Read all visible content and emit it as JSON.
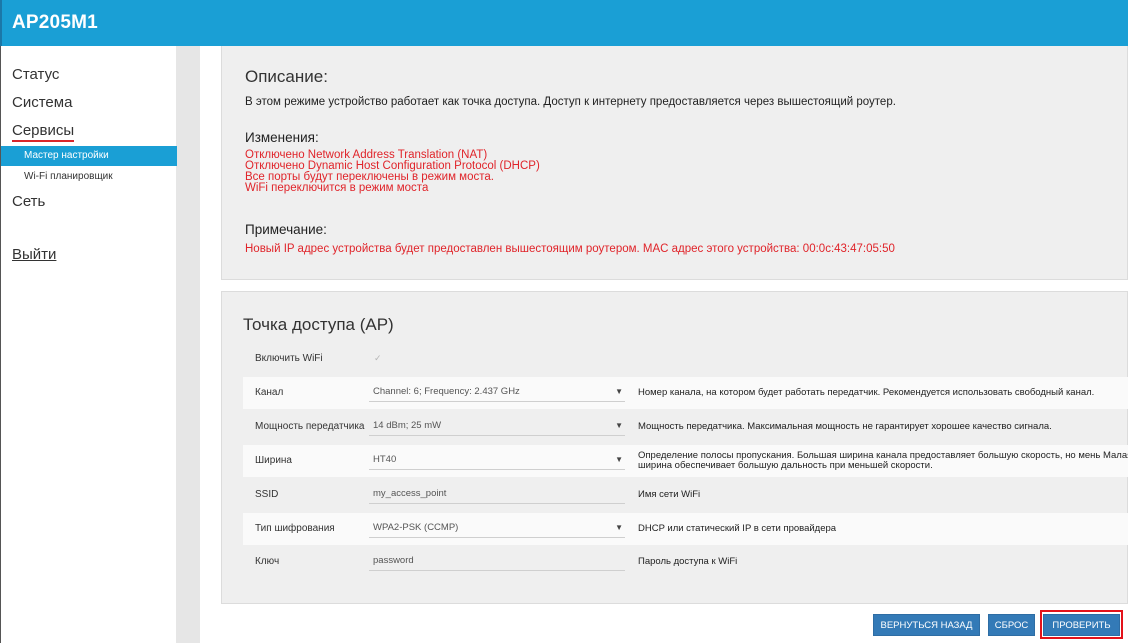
{
  "header": {
    "title": "AP205M1"
  },
  "sidebar": {
    "items": [
      {
        "label": "Статус"
      },
      {
        "label": "Система"
      },
      {
        "label": "Сервисы"
      },
      {
        "label": "Сеть"
      }
    ],
    "subitems": [
      {
        "label": "Мастер настройки",
        "active": true
      },
      {
        "label": "Wi-Fi планировщик",
        "active": false
      }
    ],
    "logout": "Выйти"
  },
  "description": {
    "heading": "Описание:",
    "text": "В этом режиме устройство работает как точка доступа. Доступ к интернету предоставляется через вышестоящий роутер."
  },
  "changes": {
    "heading": "Изменения:",
    "items": [
      "Отключено Network Address Translation (NAT)",
      "Отключено Dynamic Host Configuration Protocol (DHCP)",
      "Все порты будут переключены в режим моста.",
      "WiFi переключится в режим моста"
    ]
  },
  "note": {
    "heading": "Примечание:",
    "text": "Новый IP адрес устройства будет предоставлен вышестоящим роутером. MAC адрес этого устройства: 00:0c:43:47:05:50"
  },
  "ap_form": {
    "title": "Точка доступа (AP)",
    "enable_wifi": {
      "label": "Включить WiFi",
      "checked": true,
      "mark": "✓"
    },
    "channel": {
      "label": "Канал",
      "value": "Channel: 6; Frequency: 2.437 GHz",
      "help": "Номер канала, на котором будет работать передатчик. Рекомендуется использовать свободный канал."
    },
    "power": {
      "label": "Мощность передатчика",
      "value": "14 dBm; 25 mW",
      "help": "Мощность передатчика. Максимальная мощность не гарантирует хорошее качество сигнала."
    },
    "width": {
      "label": "Ширина",
      "value": "HT40",
      "help": "Определение полосы пропускания. Большая ширина канала предоставляет большую скорость, но мень Малая ширина обеспечивает большую дальность при меньшей скорости."
    },
    "ssid": {
      "label": "SSID",
      "value": "my_access_point",
      "help": "Имя сети WiFi"
    },
    "encryption": {
      "label": "Тип шифрования",
      "value": "WPA2-PSK (CCMP)",
      "help": "DHCP или статический IP в сети провайдера"
    },
    "key": {
      "label": "Ключ",
      "value": "password",
      "help": "Пароль доступа к WiFi"
    },
    "dropdown_arrow": "▼"
  },
  "buttons": {
    "back": "ВЕРНУТЬСЯ НАЗАД",
    "reset": "СБРОС",
    "check": "ПРОВЕРИТЬ"
  },
  "colors": {
    "header_bg": "#1a9fd5",
    "accent_red": "#e0242a",
    "button_blue": "#337ab7"
  }
}
